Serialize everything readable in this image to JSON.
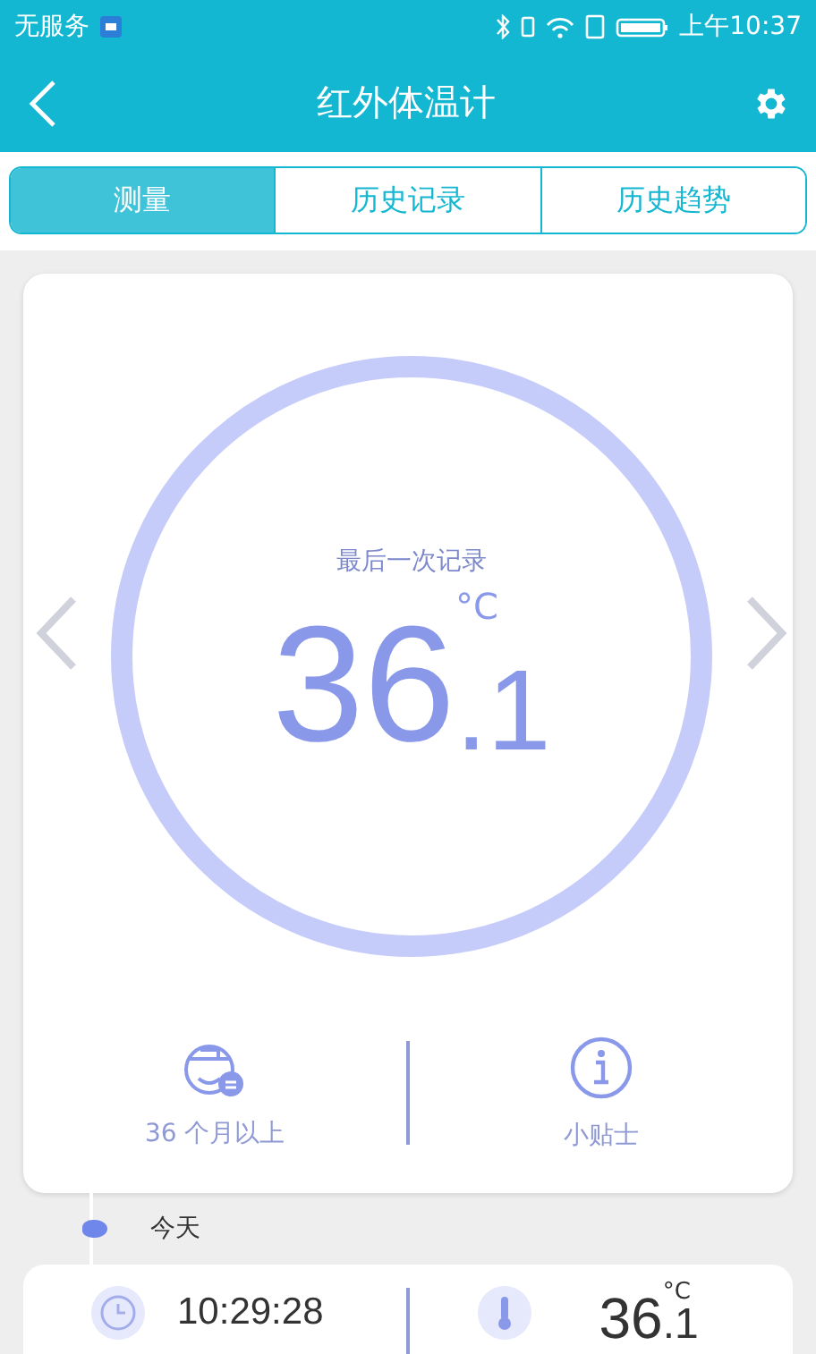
{
  "status_bar": {
    "carrier": "无服务",
    "time": "上午10:37"
  },
  "header": {
    "title": "红外体温计"
  },
  "tabs": [
    {
      "label": "测量",
      "selected": true
    },
    {
      "label": "历史记录",
      "selected": false
    },
    {
      "label": "历史趋势",
      "selected": false
    }
  ],
  "reading": {
    "caption": "最后一次记录",
    "unit": "°C",
    "whole": "36",
    "decimal": ".1"
  },
  "actions": [
    {
      "kind": "age",
      "label": "36 个月以上"
    },
    {
      "kind": "tips",
      "label": "小贴士"
    }
  ],
  "history": {
    "day": "今天",
    "records": [
      {
        "time": "10:29:28",
        "whole": "36",
        "decimal": ".1",
        "unit": "°C"
      }
    ]
  }
}
